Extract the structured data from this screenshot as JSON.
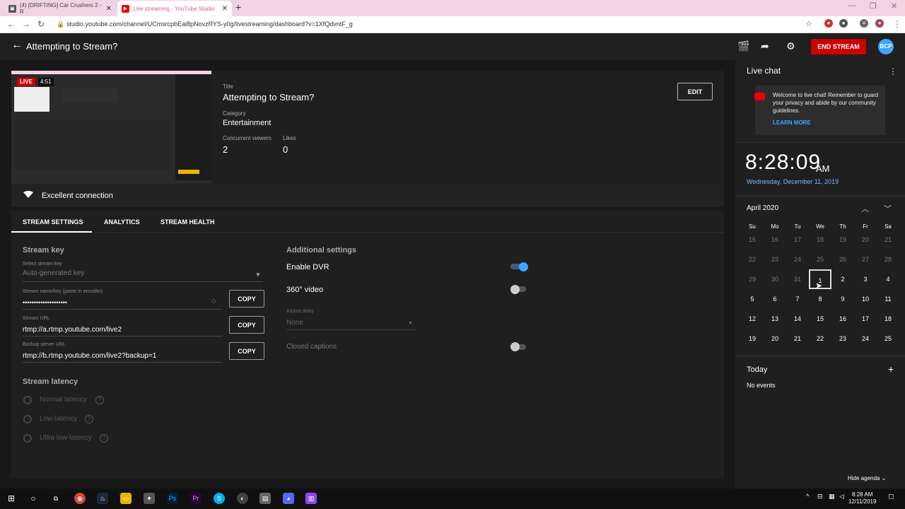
{
  "browser": {
    "tabs": [
      {
        "label": "(4) [DRIFTING] Car Crushers 2 - R"
      },
      {
        "label": "Live streaming - YouTube Studio"
      }
    ],
    "url": "studio.youtube.com/channel/UCmsrcpbEal8pNovzRYS-y0g/livestreaming/dashboard?v=1XfQdvntF_g"
  },
  "header": {
    "title": "Attempting to Stream?",
    "end_stream": "END STREAM",
    "avatar": "BCP"
  },
  "preview": {
    "live": "LIVE",
    "time": "4:51"
  },
  "info": {
    "title_label": "Title",
    "title": "Attempting to Stream?",
    "category_label": "Category",
    "category": "Entertainment",
    "viewers_label": "Concurrent viewers",
    "viewers": "2",
    "likes_label": "Likes",
    "likes": "0",
    "edit": "EDIT"
  },
  "connection": "Excellent connection",
  "tabs": [
    "STREAM SETTINGS",
    "ANALYTICS",
    "STREAM HEALTH"
  ],
  "stream_key": {
    "heading": "Stream key",
    "select_label": "Select stream key",
    "select_value": "Auto-generated key",
    "name_label": "Stream name/key (paste in encoder)",
    "name_value": "••••••••••••••••••••",
    "url_label": "Stream URL",
    "url_value": "rtmp://a.rtmp.youtube.com/live2",
    "backup_label": "Backup server URL",
    "backup_value": "rtmp://b.rtmp.youtube.com/live2?backup=1",
    "copy": "COPY"
  },
  "latency": {
    "heading": "Stream latency",
    "options": [
      "Normal latency",
      "Low-latency",
      "Ultra low-latency"
    ]
  },
  "additional": {
    "heading": "Additional settings",
    "dvr": "Enable DVR",
    "dvr_on": true,
    "video360": "360° video",
    "delay_label": "Added delay",
    "delay_value": "None",
    "captions": "Closed captions"
  },
  "chat": {
    "title": "Live chat",
    "message": "Welcome to live chat! Remember to guard your privacy and abide by our community guidelines.",
    "learn_more": "LEARN MORE"
  },
  "calendar": {
    "time": "8:28:09",
    "ampm": "AM",
    "date": "Wednesday, December 11, 2019",
    "month": "April 2020",
    "weekdays": [
      "Su",
      "Mo",
      "Tu",
      "We",
      "Th",
      "Fr",
      "Sa"
    ],
    "weeks": [
      [
        "15",
        "16",
        "17",
        "18",
        "19",
        "20",
        "21"
      ],
      [
        "22",
        "23",
        "24",
        "25",
        "26",
        "27",
        "28"
      ],
      [
        "29",
        "30",
        "31",
        "1",
        "2",
        "3",
        "4"
      ],
      [
        "5",
        "6",
        "7",
        "8",
        "9",
        "10",
        "11"
      ],
      [
        "12",
        "13",
        "14",
        "15",
        "16",
        "17",
        "18"
      ],
      [
        "19",
        "20",
        "21",
        "22",
        "23",
        "24",
        "25"
      ]
    ],
    "agenda_title": "Today",
    "no_events": "No events",
    "hide_agenda": "Hide agenda"
  },
  "taskbar": {
    "time": "8:28 AM",
    "date": "12/11/2019"
  },
  "colors": {
    "accent": "#3ea6ff",
    "brand_red": "#cc0000"
  }
}
